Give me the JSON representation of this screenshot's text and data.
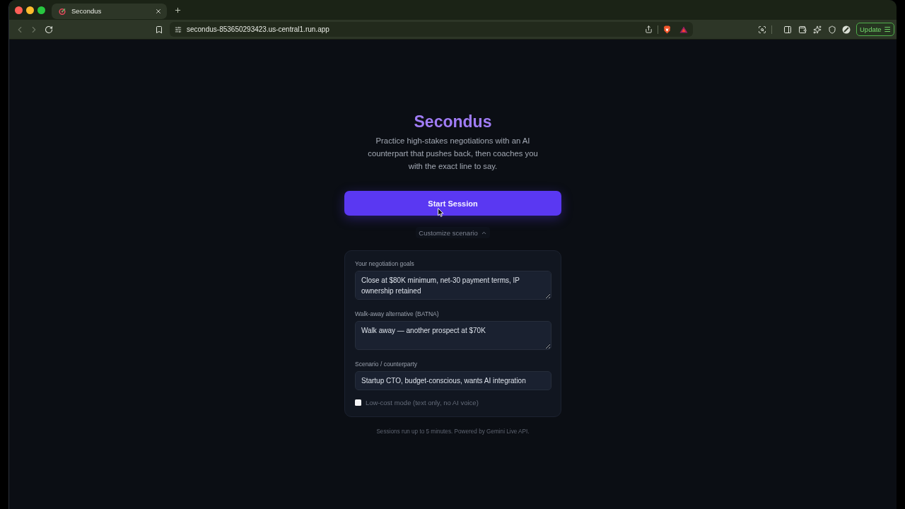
{
  "browser": {
    "tabs": [
      {
        "title": "Secondus",
        "selected": true
      }
    ],
    "url": "secondus-853650293423.us-central1.run.app",
    "update_button": "Update"
  },
  "page": {
    "title": "Secondus",
    "subtitle": "Practice high-stakes negotiations with an AI counterpart that pushes back, then coaches you with the exact line to say.",
    "start_button": "Start Session",
    "customize": {
      "label": "Customize scenario",
      "expanded": true
    },
    "fields": [
      {
        "kind": "textarea",
        "label": "Your negotiation goals",
        "value": "Close at $80K minimum, net-30 payment terms, IP ownership retained"
      },
      {
        "kind": "textarea",
        "label": "Walk-away alternative (BATNA)",
        "value": "Walk away — another prospect at $70K"
      },
      {
        "kind": "input",
        "label": "Scenario / counterparty",
        "value": "Startup CTO, budget-conscious, wants AI integration"
      }
    ],
    "low_cost_mode": {
      "label": "Low-cost mode (text only, no AI voice)",
      "checked": false
    },
    "footer": "Sessions run up to 5 minutes. Powered by Gemini Live API."
  }
}
